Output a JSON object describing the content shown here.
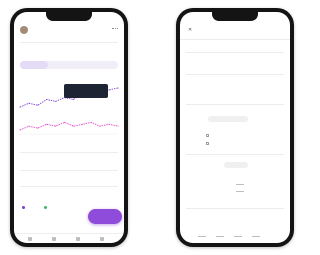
{
  "colors": {
    "accent": "#8f4bd9",
    "tooltip_bg": "#1d2433",
    "series_purple": "#7a3fd6",
    "series_magenta": "#e040c8"
  },
  "left_phone": {
    "header": {
      "avatar_icon": "user-avatar",
      "menu_icon": "more-dots-icon"
    },
    "segmented_tabs": [],
    "tooltip": {
      "lines": []
    },
    "chart_data": {
      "type": "line",
      "title": "",
      "series": [
        {
          "values": [
            22,
            24,
            23,
            26,
            25,
            27,
            26,
            29,
            28,
            30,
            31,
            32
          ]
        },
        {
          "values": [
            10,
            12,
            11,
            13,
            12,
            14,
            12,
            13,
            14,
            12,
            13,
            12
          ]
        }
      ]
    },
    "fab_label": "",
    "nav_icons": [
      "home-icon",
      "search-icon",
      "add-icon",
      "profile-icon"
    ]
  },
  "right_phone": {
    "dialog_title": "",
    "close_icon": "close-icon"
  }
}
